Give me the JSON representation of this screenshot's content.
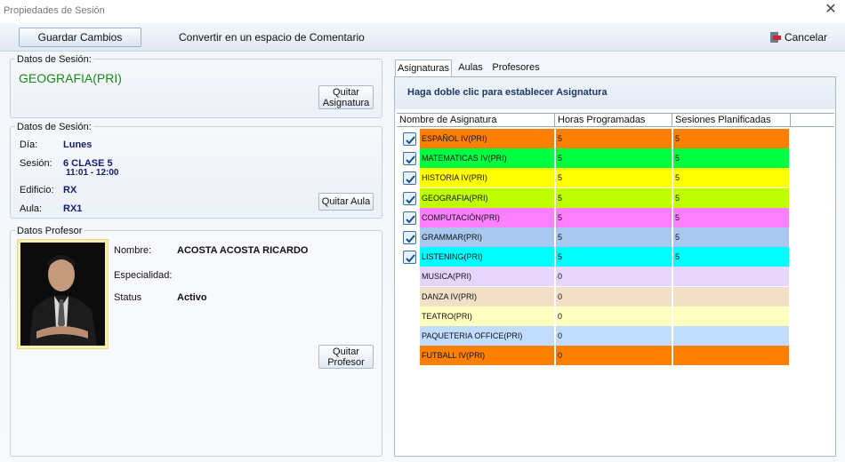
{
  "window": {
    "title": "Propiedades de Sesión"
  },
  "toolbar": {
    "save_label": "Guardar Cambios",
    "convert_label": "Convertir en un espacio de Comentario",
    "cancel_label": "Cancelar"
  },
  "datos_sesion_1": {
    "legend": "Datos de Sesión:",
    "name": "GEOGRAFIA(PRI)",
    "remove_subject_label_1": "Quitar",
    "remove_subject_label_2": "Asignatura"
  },
  "datos_sesion_2": {
    "legend": "Datos de Sesión:",
    "dia_label": "Día:",
    "dia_value": "Lunes",
    "sesion_label": "Sesión:",
    "sesion_value": "6 CLASE 5",
    "sesion_time": "11:01 - 12:00",
    "edificio_label": "Edificio:",
    "edificio_value": "RX",
    "aula_label": "Aula:",
    "aula_value": "RX1",
    "remove_room_label": "Quitar Aula"
  },
  "datos_profesor": {
    "legend": "Datos Profesor",
    "nombre_label": "Nombre:",
    "nombre_value": "ACOSTA ACOSTA RICARDO",
    "especialidad_label": "Especialidad:",
    "especialidad_value": "",
    "status_label": "Status",
    "status_value": "Activo",
    "remove_teacher_label_1": "Quitar",
    "remove_teacher_label_2": "Profesor"
  },
  "tabs": [
    {
      "label": "Asignaturas",
      "active": true
    },
    {
      "label": "Aulas",
      "active": false
    },
    {
      "label": "Profesores",
      "active": false
    }
  ],
  "asignaturas_panel": {
    "hint": "Haga doble clic para establecer Asignatura",
    "columns": [
      "Nombre de Asignatura",
      "Horas Programadas",
      "Sesiones Planificadas"
    ],
    "rows": [
      {
        "name": "ESPAÑOL IV(PRI)",
        "horas": "5",
        "sesiones": "5",
        "checked": true,
        "color": "#ff8000"
      },
      {
        "name": "MATEMATICAS IV(PRI)",
        "horas": "5",
        "sesiones": "5",
        "checked": true,
        "color": "#00ff40"
      },
      {
        "name": "HISTORIA IV(PRI)",
        "horas": "5",
        "sesiones": "5",
        "checked": true,
        "color": "#ffff00"
      },
      {
        "name": "GEOGRAFIA(PRI)",
        "horas": "5",
        "sesiones": "5",
        "checked": true,
        "color": "#c0ff00"
      },
      {
        "name": "COMPUTACIÓN(PRI)",
        "horas": "5",
        "sesiones": "5",
        "checked": true,
        "color": "#ff80ff"
      },
      {
        "name": "GRAMMAR(PRI)",
        "horas": "5",
        "sesiones": "5",
        "checked": true,
        "color": "#a8c8f0"
      },
      {
        "name": "LISTENING(PRI)",
        "horas": "5",
        "sesiones": "5",
        "checked": true,
        "color": "#00ffff"
      },
      {
        "name": "MUSICA(PRI)",
        "horas": "0",
        "sesiones": "",
        "checked": false,
        "color": "#e6d6ff"
      },
      {
        "name": "DANZA IV(PRI)",
        "horas": "0",
        "sesiones": "",
        "checked": false,
        "color": "#f2dfc8"
      },
      {
        "name": "TEATRO(PRI)",
        "horas": "0",
        "sesiones": "",
        "checked": false,
        "color": "#ffffc0"
      },
      {
        "name": "PAQUETERIA OFFICE(PRI)",
        "horas": "0",
        "sesiones": "",
        "checked": false,
        "color": "#c0dcff"
      },
      {
        "name": "FUTBALL IV(PRI)",
        "horas": "0",
        "sesiones": "",
        "checked": false,
        "color": "#ff8000"
      }
    ]
  }
}
